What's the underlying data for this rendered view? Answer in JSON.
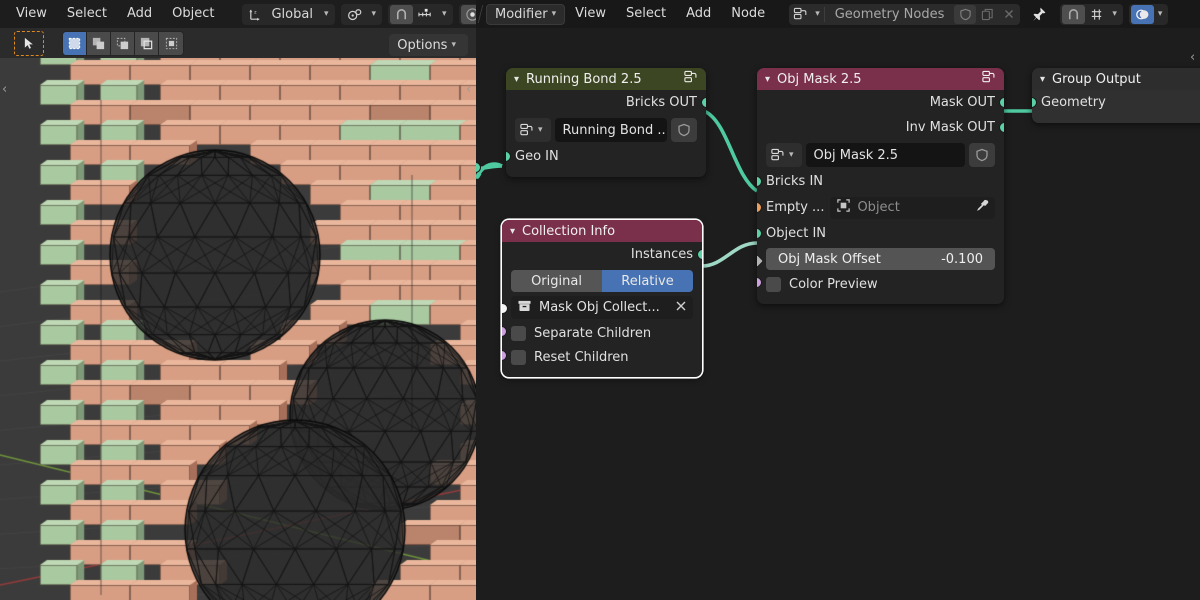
{
  "viewport": {
    "menus": [
      "View",
      "Select",
      "Add",
      "Object"
    ],
    "transform_orientation": "Global",
    "icons": {
      "orientation": "axis-gizmo-icon",
      "orientation_chevron": "chevron-down-icon",
      "pivot": "pivot-point-icon",
      "pivot_chevron": "chevron-down-icon",
      "snap_magnet": "magnet-icon",
      "snap_mode": "snap-increment-icon",
      "snap_chevron": "chevron-down-icon",
      "proportional": "proportional-edit-icon",
      "cursor_tool": "tweak-select-tool-icon",
      "sel_set": "select-set-icon",
      "sel_extend": "select-extend-icon",
      "sel_subtract": "select-subtract-icon",
      "sel_invert": "select-invert-icon",
      "sel_intersect": "select-intersect-icon",
      "region_expand_left": "region-expand-arrow-icon",
      "region_collapse_right": "region-collapse-arrow-icon"
    },
    "options_label": "Options",
    "options_chevron": "chevron-down-icon"
  },
  "node_editor": {
    "header": {
      "context_label": "Modifier",
      "context_chevron": "chevron-down-icon",
      "menus": [
        "View",
        "Select",
        "Add",
        "Node"
      ],
      "datablock_icon": "geometry-nodes-icon",
      "datablock_chevron": "chevron-down-icon",
      "datablock_name": "Geometry Nodes",
      "shield_icon": "fake-user-shield-icon",
      "copy_icon": "new-copy-icon",
      "close_icon": "unlink-x-icon",
      "pin_icon": "pin-icon",
      "snap_magnet_icon": "magnet-icon",
      "snap_mode_icon": "snap-grid-icon",
      "snap_chevron": "chevron-down-icon",
      "overlay_icon": "node-overlay-icon",
      "overlay_chevron": "chevron-down-icon"
    },
    "nodes": [
      {
        "id": "running-bond",
        "title": "Running Bond 2.5",
        "header_color": "#3c4622",
        "collapse_icon": "chevron-down-icon",
        "group_icon": "node-group-icon",
        "selected": false,
        "outputs": [
          {
            "label": "Bricks OUT",
            "type": "geo"
          }
        ],
        "idblock": {
          "picker_icon": "node-group-icon",
          "picker_chevron": "chevron-down-icon",
          "name": "Running Bond ...",
          "shield_icon": "fake-user-shield-icon"
        },
        "inputs": [
          {
            "label": "Geo IN",
            "type": "geo"
          }
        ]
      },
      {
        "id": "obj-mask",
        "title": "Obj Mask 2.5",
        "header_color": "#7a2f4a",
        "collapse_icon": "chevron-down-icon",
        "group_icon": "node-group-icon",
        "selected": false,
        "outputs": [
          {
            "label": "Mask OUT",
            "type": "geo"
          },
          {
            "label": "Inv Mask OUT",
            "type": "geo"
          }
        ],
        "idblock": {
          "picker_icon": "node-group-icon",
          "picker_chevron": "chevron-down-icon",
          "name": "Obj Mask 2.5",
          "shield_icon": "fake-user-shield-icon"
        },
        "inputs": [
          {
            "label": "Bricks IN",
            "type": "geo"
          },
          {
            "label": "Empty ...",
            "type": "obj",
            "field_placeholder": "Object",
            "field_icon": "object-data-icon",
            "eyedropper_icon": "eyedropper-icon"
          },
          {
            "label": "Object IN",
            "type": "geo"
          },
          {
            "label": "Obj Mask Offset",
            "type": "flt",
            "value": "-0.100"
          },
          {
            "label": "Color Preview",
            "type": "bool",
            "checked": false
          }
        ]
      },
      {
        "id": "collection-info",
        "title": "Collection Info",
        "header_color": "#7a2f4a",
        "collapse_icon": "chevron-down-icon",
        "selected": true,
        "outputs": [
          {
            "label": "Instances",
            "type": "geo"
          }
        ],
        "transform_space": {
          "options": [
            "Original",
            "Relative"
          ],
          "active": "Relative"
        },
        "collection": {
          "icon": "collection-icon",
          "name": "Mask Obj Collect...",
          "clear_icon": "x-clear-icon"
        },
        "inputs": [
          {
            "label": "Separate Children",
            "type": "bool",
            "checked": false
          },
          {
            "label": "Reset Children",
            "type": "bool",
            "checked": false
          }
        ]
      },
      {
        "id": "group-output",
        "title": "Group Output",
        "header_color": "#2d2d2d",
        "collapse_icon": "chevron-down-icon",
        "selected": false,
        "inputs": [
          {
            "label": "Geometry",
            "type": "geo"
          }
        ]
      }
    ],
    "noodle_color": "#4ec9a0"
  },
  "colors": {
    "accent_blue": "#4772b3",
    "node_geo_socket": "#5bd1a5",
    "node_object_socket": "#ed9e5c",
    "node_bool_socket": "#cda0de",
    "node_collection_socket": "#f5f5f5",
    "brick_face": "#d79e84",
    "brick_green": "#a9c9a0",
    "viewport_bg": "#3b3b3b"
  }
}
